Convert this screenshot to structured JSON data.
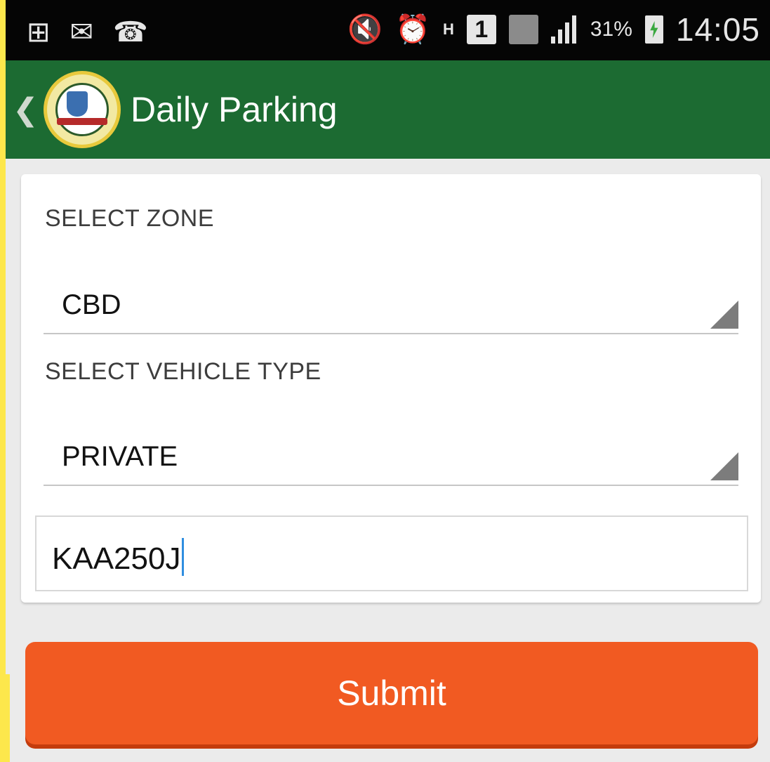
{
  "status_bar": {
    "left_icons": [
      "add-icon",
      "mail-icon",
      "missed-call-icon"
    ],
    "right_icons": [
      "mute-icon",
      "alarm-icon",
      "h-network-icon",
      "sim-1-icon",
      "sim-2-icon",
      "signal-icon",
      "battery-charging-icon"
    ],
    "network_label": "H",
    "sim_label": "1",
    "battery": "31%",
    "time": "14:05"
  },
  "app_bar": {
    "title": "Daily Parking",
    "color": "#1c6b32"
  },
  "form": {
    "zone_label": "SELECT ZONE",
    "zone_value": "CBD",
    "vehicle_type_label": "SELECT VEHICLE TYPE",
    "vehicle_type_value": "PRIVATE",
    "plate_value": "KAA250J"
  },
  "submit_label": "Submit",
  "colors": {
    "accent": "#f15a22",
    "background": "#ebebeb",
    "caret": "#2f8ee0"
  }
}
